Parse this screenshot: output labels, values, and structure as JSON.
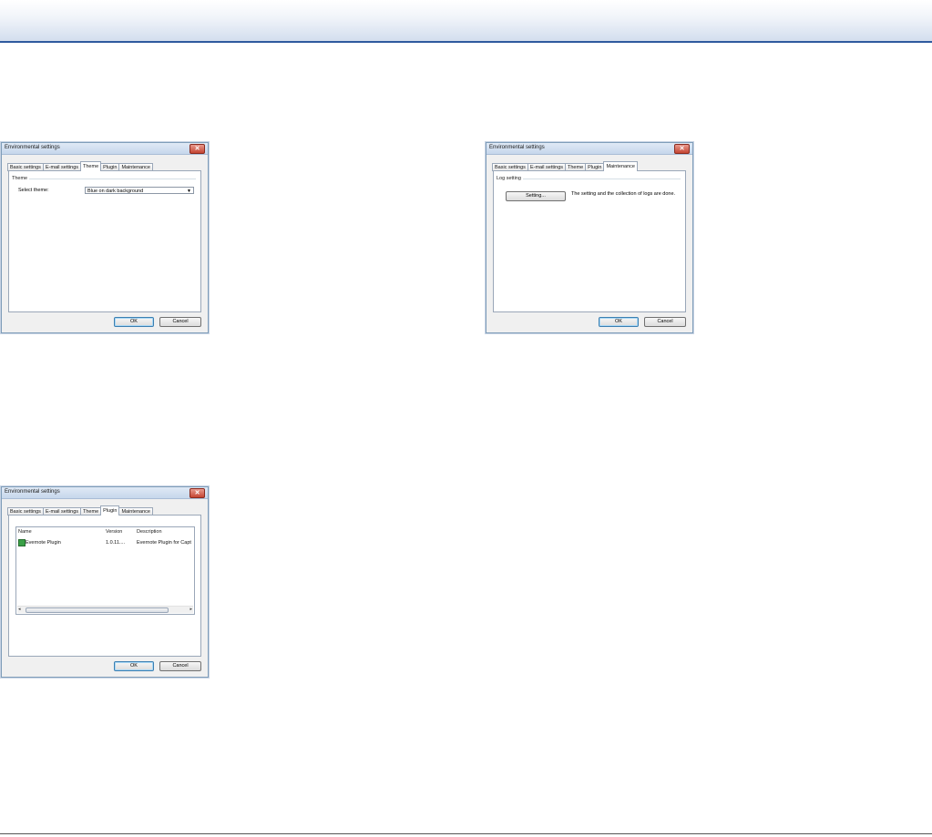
{
  "dialogs": {
    "theme": {
      "title": "Environmental settings",
      "tabs": [
        "Basic settings",
        "E-mail settings",
        "Theme",
        "Plugin",
        "Maintenance"
      ],
      "active_tab": "Theme",
      "group_label": "Theme",
      "select_label": "Select theme:",
      "select_value": "Blue on dark background",
      "ok": "OK",
      "cancel": "Cancel"
    },
    "maintenance": {
      "title": "Environmental settings",
      "tabs": [
        "Basic settings",
        "E-mail settings",
        "Theme",
        "Plugin",
        "Maintenance"
      ],
      "active_tab": "Maintenance",
      "group_label": "Log setting",
      "setting_button": "Setting...",
      "description": "The setting and the collection of logs are done.",
      "ok": "OK",
      "cancel": "Cancel"
    },
    "plugin": {
      "title": "Environmental settings",
      "tabs": [
        "Basic settings",
        "E-mail settings",
        "Theme",
        "Plugin",
        "Maintenance"
      ],
      "active_tab": "Plugin",
      "columns": [
        "Name",
        "Version",
        "Description"
      ],
      "rows": [
        {
          "name": "Evernote Plugin",
          "version": "1.0.11....",
          "description": "Evernote Plugin for Capt"
        }
      ],
      "ok": "OK",
      "cancel": "Cancel"
    }
  },
  "icons": {
    "close": "close-icon",
    "dropdown": "chevron-down-icon",
    "plugin": "plugin-icon"
  },
  "colors": {
    "header_rule": "#2f5a9e",
    "dialog_bg": "#f0f0f0",
    "close_button": "#c54532"
  }
}
